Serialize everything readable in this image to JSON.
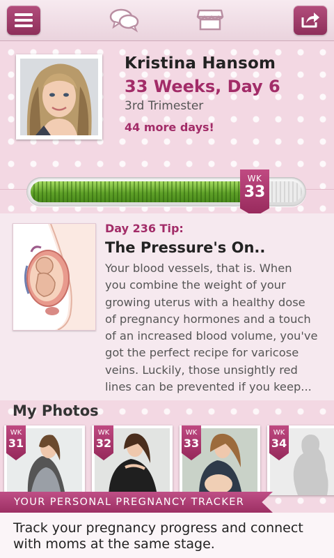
{
  "profile": {
    "name": "Kristina Hansom",
    "pregnancy_week": "33 Weeks, Day 6",
    "trimester": "3rd Trimester",
    "days_remaining": "44 more days!"
  },
  "progress": {
    "wk_label": "WK",
    "current_week": "33",
    "fraction": 0.825
  },
  "tip": {
    "label": "Day 236 Tip:",
    "title": "The Pressure's On..",
    "body": "Your blood vessels, that is. When\nyou combine the weight of your\ngrowing uterus with a healthy dose\nof pregnancy hormones and a touch\nof an increased blood volume, you've\ngot the perfect recipe for varicose\nveins. Luckily, those unsightly red\nlines can be prevented if you keep..."
  },
  "photos": {
    "title": "My Photos",
    "items": [
      {
        "wk_label": "WK",
        "week": "31"
      },
      {
        "wk_label": "WK",
        "week": "32"
      },
      {
        "wk_label": "WK",
        "week": "33"
      },
      {
        "wk_label": "WK",
        "week": "34"
      }
    ]
  },
  "banner": {
    "text": "YOUR PERSONAL PREGNANCY TRACKER",
    "subtext": "Track your pregnancy progress and connect with moms at the same stage."
  },
  "toolbar": {
    "icons": [
      "menu-icon",
      "chat-icon",
      "store-icon",
      "share-icon"
    ]
  },
  "colors": {
    "accent": "#a22c68",
    "progress_green": "#5fa128",
    "background_pink": "#f3d8e3"
  }
}
